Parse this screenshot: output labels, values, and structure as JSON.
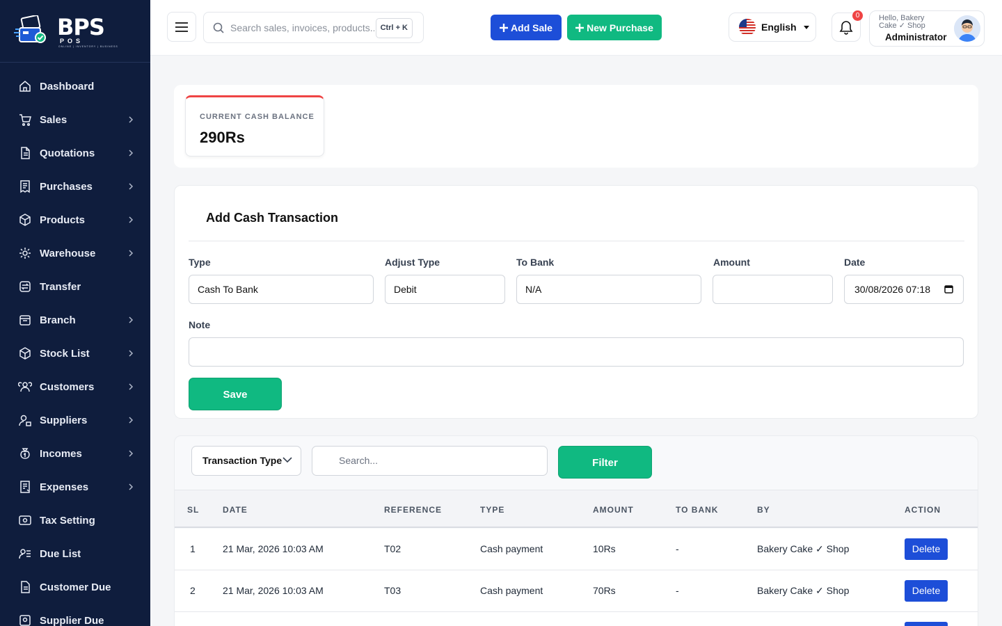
{
  "brand": {
    "logo_text": "BPS",
    "logo_sub": "POS",
    "logo_tag": "ONLINE | INVENTORY | BUSINESS"
  },
  "sidebar": {
    "items": [
      {
        "label": "Dashboard",
        "icon": "home-icon",
        "chevron": false
      },
      {
        "label": "Sales",
        "icon": "cart-icon",
        "chevron": true
      },
      {
        "label": "Quotations",
        "icon": "document-icon",
        "chevron": true
      },
      {
        "label": "Purchases",
        "icon": "receipt-icon",
        "chevron": true
      },
      {
        "label": "Products",
        "icon": "box-icon",
        "chevron": true
      },
      {
        "label": "Warehouse",
        "icon": "warehouse-icon",
        "chevron": true
      },
      {
        "label": "Transfer",
        "icon": "transfer-icon",
        "chevron": false
      },
      {
        "label": "Branch",
        "icon": "branch-icon",
        "chevron": true
      },
      {
        "label": "Stock List",
        "icon": "stock-icon",
        "chevron": true
      },
      {
        "label": "Customers",
        "icon": "customers-icon",
        "chevron": true
      },
      {
        "label": "Suppliers",
        "icon": "suppliers-icon",
        "chevron": true
      },
      {
        "label": "Incomes",
        "icon": "money-bag-icon",
        "chevron": true
      },
      {
        "label": "Expenses",
        "icon": "expense-icon",
        "chevron": true
      },
      {
        "label": "Tax Setting",
        "icon": "tax-icon",
        "chevron": false
      },
      {
        "label": "Due List",
        "icon": "due-list-icon",
        "chevron": false
      },
      {
        "label": "Customer Due",
        "icon": "customer-due-icon",
        "chevron": false
      },
      {
        "label": "Supplier Due",
        "icon": "supplier-due-icon",
        "chevron": false
      }
    ]
  },
  "header": {
    "search_placeholder": "Search sales, invoices, products...",
    "shortcut": "Ctrl + K",
    "add_sale": "Add Sale",
    "new_purchase": "New Purchase",
    "language": "English",
    "notifications": "0",
    "greeting": "Hello, Bakery Cake ✓ Shop",
    "role": "Administrator"
  },
  "balance": {
    "label": "CURRENT CASH BALANCE",
    "value": "290Rs"
  },
  "form": {
    "title": "Add Cash Transaction",
    "type_label": "Type",
    "type_value": "Cash To Bank",
    "adjust_label": "Adjust Type",
    "adjust_value": "Debit",
    "bank_label": "To Bank",
    "bank_value": "N/A",
    "amount_label": "Amount",
    "amount_value": "",
    "date_label": "Date",
    "date_value": "30/08/2026 07:18",
    "note_label": "Note",
    "note_value": "",
    "save": "Save"
  },
  "list": {
    "type_filter": "Transaction Type",
    "search_placeholder": "Search...",
    "filter": "Filter",
    "columns": [
      "SL",
      "DATE",
      "REFERENCE",
      "TYPE",
      "AMOUNT",
      "TO BANK",
      "BY",
      "ACTION"
    ],
    "rows": [
      {
        "sl": "1",
        "date": "21 Mar, 2026 10:03 AM",
        "ref": "T02",
        "type": "Cash payment",
        "amount": "10Rs",
        "bank": "-",
        "by": "Bakery Cake ✓ Shop",
        "action": "Delete"
      },
      {
        "sl": "2",
        "date": "21 Mar, 2026 10:03 AM",
        "ref": "T03",
        "type": "Cash payment",
        "amount": "70Rs",
        "bank": "-",
        "by": "Bakery Cake ✓ Shop",
        "action": "Delete"
      }
    ]
  },
  "colors": {
    "sidebar": "#0f1d3d",
    "primary": "#1d4ed8",
    "success": "#10b981",
    "danger": "#ef4444"
  }
}
